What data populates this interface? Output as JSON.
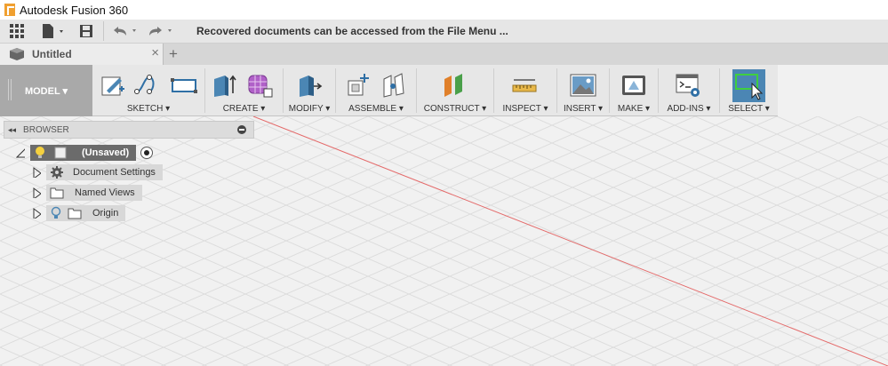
{
  "app": {
    "title": "Autodesk Fusion 360"
  },
  "qat": {
    "message": "Recovered documents can be accessed from the File Menu ..."
  },
  "tabs": {
    "active_title": "Untitled",
    "close_symbol": "×",
    "add_symbol": "+"
  },
  "toolbar": {
    "model_label": "MODEL ▾",
    "groups": [
      {
        "label": "SKETCH ▾"
      },
      {
        "label": "CREATE ▾"
      },
      {
        "label": "MODIFY ▾"
      },
      {
        "label": "ASSEMBLE ▾"
      },
      {
        "label": "CONSTRUCT ▾"
      },
      {
        "label": "INSPECT ▾"
      },
      {
        "label": "INSERT ▾"
      },
      {
        "label": "MAKE ▾"
      },
      {
        "label": "ADD-INS ▾"
      },
      {
        "label": "SELECT ▾"
      }
    ]
  },
  "browser": {
    "title": "BROWSER",
    "collapse_symbol": "◂◂",
    "root": {
      "label": "(Unsaved)"
    },
    "items": [
      {
        "label": "Document Settings"
      },
      {
        "label": "Named Views"
      },
      {
        "label": "Origin"
      }
    ]
  },
  "colors": {
    "accent_select": "#4b86b4",
    "model_bg": "#a9a9a9",
    "axis_red": "#e46a6a"
  }
}
